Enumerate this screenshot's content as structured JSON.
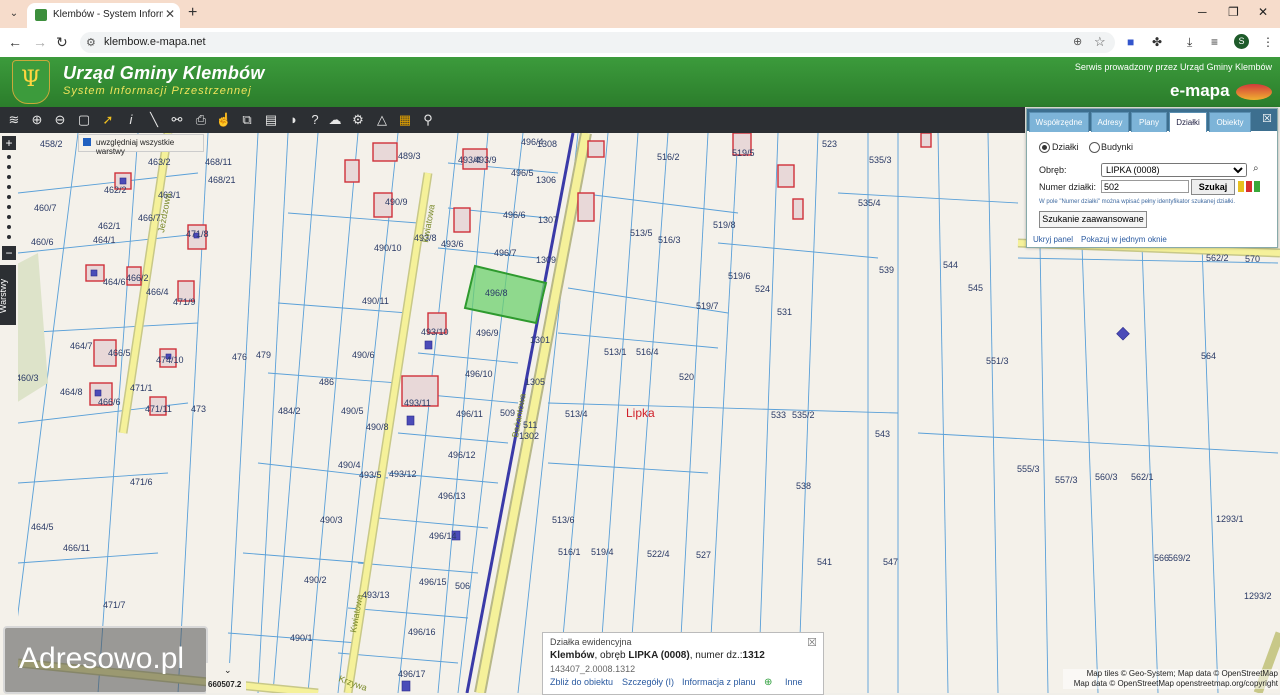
{
  "browser": {
    "tab_title": "Klembów - System Informacji P",
    "tab_close": "✕",
    "new_tab": "+",
    "url": "klembow.e-mapa.net",
    "profile_initial": "S"
  },
  "header": {
    "title": "Urząd Gminy Klembów",
    "subtitle": "System Informacji Przestrzennej",
    "service_note": "Serwis prowadzony przez Urząd Gminy Klembów",
    "brand": "e-mapa"
  },
  "toolbar": {
    "icons": [
      "layers-icon",
      "zoom-in-icon",
      "zoom-out-icon",
      "zoom-extent-icon",
      "select-arrow-icon",
      "info-icon",
      "measure-icon",
      "link-icon",
      "print-icon",
      "hand-icon",
      "toggle-icon",
      "table-icon",
      "speech-icon",
      "help-icon",
      "cloud-icon",
      "settings-icon",
      "warning-icon",
      "color-grid-icon",
      "gps-icon"
    ]
  },
  "layers_checkbox": {
    "label": "uwzględniaj wszystkie warstwy"
  },
  "layers_tab": {
    "label": "Warstwy"
  },
  "search_panel": {
    "tabs": [
      "Współrzędne",
      "Adresy",
      "Plany",
      "Działki",
      "Obiekty"
    ],
    "active_tab": "Działki",
    "radio_dzialki": "Działki",
    "radio_budynki": "Budynki",
    "obreb_label": "Obręb:",
    "obreb_value": "LIPKA (0008)",
    "numer_label": "Numer działki:",
    "numer_value": "502",
    "search_button": "Szukaj",
    "hint": "W pole \"Numer działki\" można wpisać pełny identyfikator szukanej działki.",
    "advanced_button": "Szukanie zaawansowane",
    "link_hide": "Ukryj panel",
    "link_window": "Pokazuj w jednym oknie"
  },
  "info_popup": {
    "header": "Działka ewidencyjna",
    "place": "Klembów",
    "mid_text": ", obręb ",
    "obreb": "LIPKA (0008)",
    "num_text": ", numer dz.:",
    "numer": "1312",
    "code": "143407_2.0008.1312",
    "actions": [
      "Zbliż do obiektu",
      "Szczegóły (I)",
      "Informacja z planu",
      "Inne"
    ]
  },
  "watermark": "Adresowo.pl",
  "coordinate": "660507.2",
  "attribution": {
    "line1": "Map tiles © Geo-System; Map data © OpenStreetMap",
    "line2": "Map data © OpenStreetMap  openstreetmap.org/copyright"
  },
  "map": {
    "locality": "Lipka",
    "roads": [
      "Jeżdzowa",
      "Kwiatowa",
      "Kwiatowa",
      "Bażantowa",
      "Krzywa"
    ],
    "parcels": [
      "458/2",
      "463/2",
      "468/11",
      "468/21",
      "462/2",
      "463/1",
      "460/7",
      "460/6",
      "466/7",
      "462/1",
      "464/1",
      "471/8",
      "464/6",
      "466/2",
      "466/4",
      "471/9",
      "464/7",
      "466/5",
      "474/10",
      "460/3",
      "464/8",
      "466/6",
      "471/1",
      "471/11",
      "476",
      "479",
      "473",
      "486",
      "484/2",
      "471/6",
      "464/5",
      "466/11",
      "471/7",
      "489/3",
      "493/4",
      "496/4",
      "496/5",
      "496/6",
      "496/7",
      "496/8",
      "496/9",
      "496/10",
      "496/11",
      "496/12",
      "496/13",
      "496/14",
      "496/15",
      "496/16",
      "496/17",
      "490/9",
      "490/10",
      "490/11",
      "490/6",
      "490/5",
      "490/8",
      "490/4",
      "490/3",
      "490/2",
      "490/1",
      "493/8",
      "493/6",
      "493/10",
      "493/11",
      "493/9",
      "493/12",
      "493/5",
      "493/13",
      "1308",
      "1306",
      "1307",
      "1309",
      "1301",
      "1305",
      "1302",
      "506",
      "509",
      "511",
      "513/4",
      "513/5",
      "513/1",
      "513/6",
      "516/1",
      "516/2",
      "516/3",
      "516/4",
      "519/4",
      "519/5",
      "519/8",
      "519/6",
      "519/7",
      "520",
      "522/4",
      "523",
      "524",
      "527",
      "531",
      "533",
      "535/2",
      "535/3",
      "535/4",
      "538",
      "539",
      "541",
      "543",
      "544",
      "545",
      "547",
      "551/3",
      "555/3",
      "557/3",
      "560/3",
      "562/1",
      "562/2",
      "564",
      "566",
      "569/2",
      "570",
      "1293/1",
      "1293/2"
    ]
  }
}
